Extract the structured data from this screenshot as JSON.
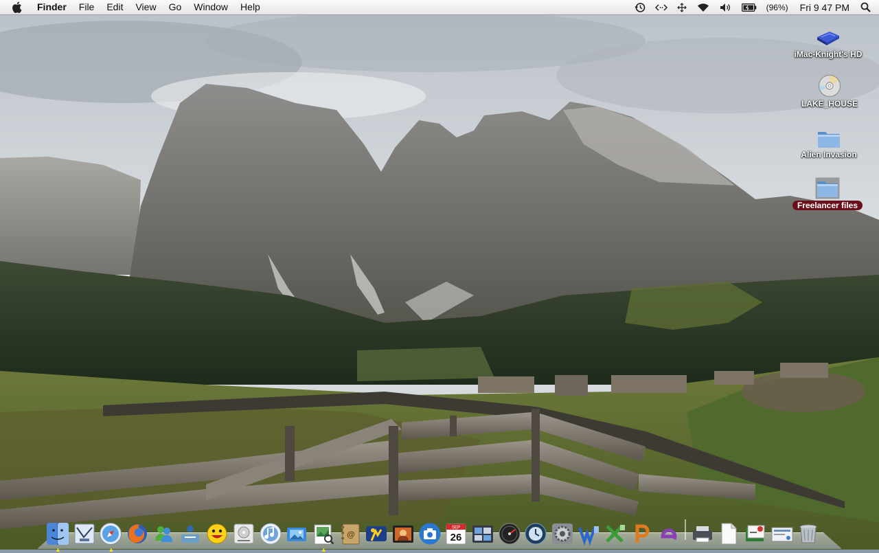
{
  "menubar": {
    "app_name": "Finder",
    "menus": [
      "File",
      "Edit",
      "View",
      "Go",
      "Window",
      "Help"
    ],
    "status": {
      "time_machine_icon": "time-machine-icon",
      "remote_icon": "remote-desktop-icon",
      "bluetooth_icon": "bluetooth-icon",
      "wifi_icon": "wifi-icon",
      "volume_icon": "volume-icon",
      "battery_percent": "(96%)",
      "clock": "Fri 9 47 PM",
      "spotlight_icon": "spotlight-search-icon"
    }
  },
  "desktop": {
    "icons": [
      {
        "label": "iMac-Knight's HD",
        "icon": "hard-drive-icon",
        "selected": false
      },
      {
        "label": "LAKE_HOUSE",
        "icon": "disc-icon",
        "selected": false
      },
      {
        "label": "Alien Invasion",
        "icon": "folder-icon",
        "selected": false
      },
      {
        "label": "Freelancer files",
        "icon": "folder-icon",
        "selected": true
      }
    ]
  },
  "dock": {
    "items": [
      {
        "name": "finder",
        "running": true
      },
      {
        "name": "mail",
        "running": false
      },
      {
        "name": "safari",
        "running": true
      },
      {
        "name": "firefox",
        "running": false
      },
      {
        "name": "msn-messenger",
        "running": false
      },
      {
        "name": "migration-assistant",
        "running": false
      },
      {
        "name": "yahoo-messenger",
        "running": false
      },
      {
        "name": "dvd-player",
        "running": false
      },
      {
        "name": "itunes",
        "running": false
      },
      {
        "name": "iphoto",
        "running": false
      },
      {
        "name": "preview",
        "running": true
      },
      {
        "name": "address-book",
        "running": false
      },
      {
        "name": "ichat",
        "running": false
      },
      {
        "name": "photo-booth",
        "running": false
      },
      {
        "name": "image-capture",
        "running": false
      },
      {
        "name": "ical",
        "running": false
      },
      {
        "name": "spaces",
        "running": false
      },
      {
        "name": "dashboard",
        "running": false
      },
      {
        "name": "time-machine",
        "running": false
      },
      {
        "name": "system-preferences",
        "running": false
      },
      {
        "name": "word",
        "running": false
      },
      {
        "name": "excel",
        "running": false
      },
      {
        "name": "powerpoint",
        "running": false
      },
      {
        "name": "entourage",
        "running": false
      },
      {
        "name": "printer",
        "running": false
      },
      {
        "name": "documents",
        "running": false
      },
      {
        "name": "downloads",
        "running": false
      },
      {
        "name": "mail-stack",
        "running": false
      },
      {
        "name": "trash",
        "running": false
      }
    ],
    "ical_day": "26",
    "ical_month": "SEP"
  }
}
